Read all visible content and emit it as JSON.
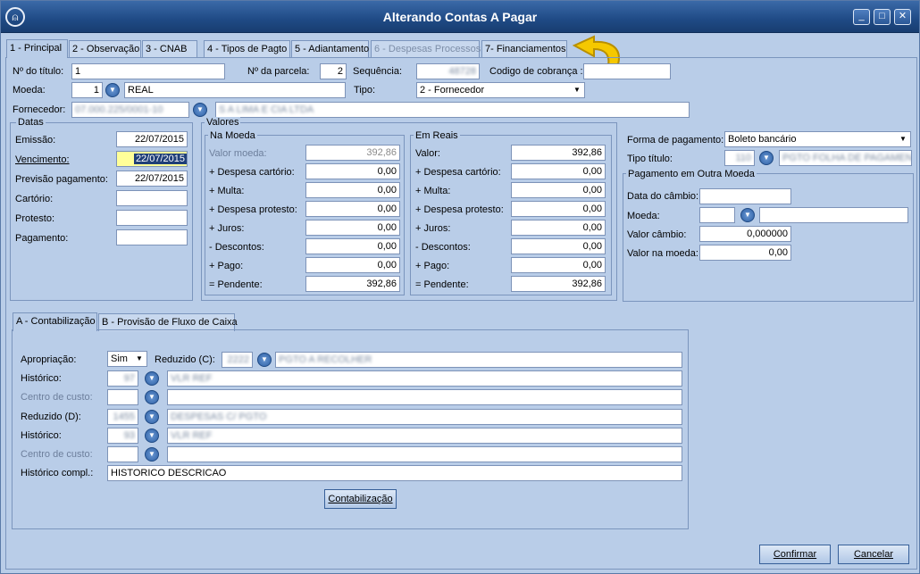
{
  "window": {
    "title": "Alterando Contas A Pagar",
    "min": "_",
    "max": "□",
    "close": "✕"
  },
  "tabs": [
    {
      "label": "1 - Principal"
    },
    {
      "label": "2 - Observação"
    },
    {
      "label": "3 - CNAB"
    },
    {
      "label": "4 - Tipos de Pagto"
    },
    {
      "label": "5 - Adiantamento"
    },
    {
      "label": "6 - Despesas Processos"
    },
    {
      "label": "7- Financiamentos"
    }
  ],
  "header": {
    "titulo_label": "Nº do título:",
    "titulo": "1",
    "parcela_label": "Nº da parcela:",
    "parcela": "2",
    "sequencia_label": "Sequência:",
    "sequencia": "48728",
    "cobranca_label": "Codigo de cobrança :",
    "cobranca": "",
    "moeda_label": "Moeda:",
    "moeda_cod": "1",
    "moeda_nome": "REAL",
    "tipo_label": "Tipo:",
    "tipo": "2 - Fornecedor",
    "fornecedor_label": "Fornecedor:",
    "fornecedor_doc": "07.000.225/0001-10",
    "fornecedor_nome": "S A LIMA E CIA LTDA"
  },
  "datas": {
    "title": "Datas",
    "emissao_label": "Emissão:",
    "emissao": "22/07/2015",
    "vencimento_label": "Vencimento:",
    "vencimento": "22/07/2015",
    "previsao_label": "Previsão pagamento:",
    "previsao": "22/07/2015",
    "cartorio_label": "Cartório:",
    "protesto_label": "Protesto:",
    "pagamento_label": "Pagamento:"
  },
  "valores": {
    "title": "Valores",
    "na_moeda": {
      "title": "Na Moeda",
      "rows": [
        {
          "label": "Valor moeda:",
          "value": "392,86"
        },
        {
          "label": "+ Despesa cartório:",
          "value": "0,00"
        },
        {
          "label": "+ Multa:",
          "value": "0,00"
        },
        {
          "label": "+ Despesa protesto:",
          "value": "0,00"
        },
        {
          "label": "+ Juros:",
          "value": "0,00"
        },
        {
          "label": "- Descontos:",
          "value": "0,00"
        },
        {
          "label": "+ Pago:",
          "value": "0,00"
        },
        {
          "label": "= Pendente:",
          "value": "392,86"
        }
      ]
    },
    "em_reais": {
      "title": "Em Reais",
      "rows": [
        {
          "label": "Valor:",
          "value": "392,86"
        },
        {
          "label": "+ Despesa cartório:",
          "value": "0,00"
        },
        {
          "label": "+ Multa:",
          "value": "0,00"
        },
        {
          "label": "+ Despesa protesto:",
          "value": "0,00"
        },
        {
          "label": "+ Juros:",
          "value": "0,00"
        },
        {
          "label": "- Descontos:",
          "value": "0,00"
        },
        {
          "label": "+ Pago:",
          "value": "0,00"
        },
        {
          "label": "= Pendente:",
          "value": "392,86"
        }
      ]
    }
  },
  "pagamento": {
    "forma_label": "Forma de pagamento:",
    "forma": "Boleto bancário",
    "tipo_titulo_label": "Tipo título:",
    "tipo_titulo_cod": "110",
    "tipo_titulo_nome": "PGTO FOLHA DE PAGAMENTO",
    "outra_moeda_title": "Pagamento em Outra Moeda",
    "data_cambio_label": "Data do câmbio:",
    "moeda_label": "Moeda:",
    "valor_cambio_label": "Valor câmbio:",
    "valor_cambio": "0,000000",
    "valor_moeda_label": "Valor na moeda:",
    "valor_moeda": "0,00"
  },
  "subtabs": [
    {
      "label": "A - Contabilização"
    },
    {
      "label": "B - Provisão de Fluxo de Caixa"
    }
  ],
  "contab": {
    "apropriacao_label": "Apropriação:",
    "apropriacao": "Sim",
    "reduzido_c_label": "Reduzido (C):",
    "reduzido_c": "2222",
    "reduzido_c_nome": "PGTO A RECOLHER",
    "historico1_label": "Histórico:",
    "historico1": "97",
    "historico1_nome": "VLR REF",
    "centro1_label": "Centro de custo:",
    "reduzido_d_label": "Reduzido (D):",
    "reduzido_d": "1455",
    "reduzido_d_nome": "DESPESAS C/ PGTO",
    "historico2_label": "Histórico:",
    "historico2": "93",
    "historico2_nome": "VLR REF",
    "centro2_label": "Centro de custo:",
    "hist_compl_label": "Histórico compl.:",
    "hist_compl": "HISTORICO DESCRICAO",
    "contab_button": "Contabilização"
  },
  "footer": {
    "confirmar": "Confirmar",
    "cancelar": "Cancelar"
  },
  "colors": {
    "title_bar": "#1f4a85",
    "background": "#b9cde8",
    "arrow": "#f5c800"
  }
}
